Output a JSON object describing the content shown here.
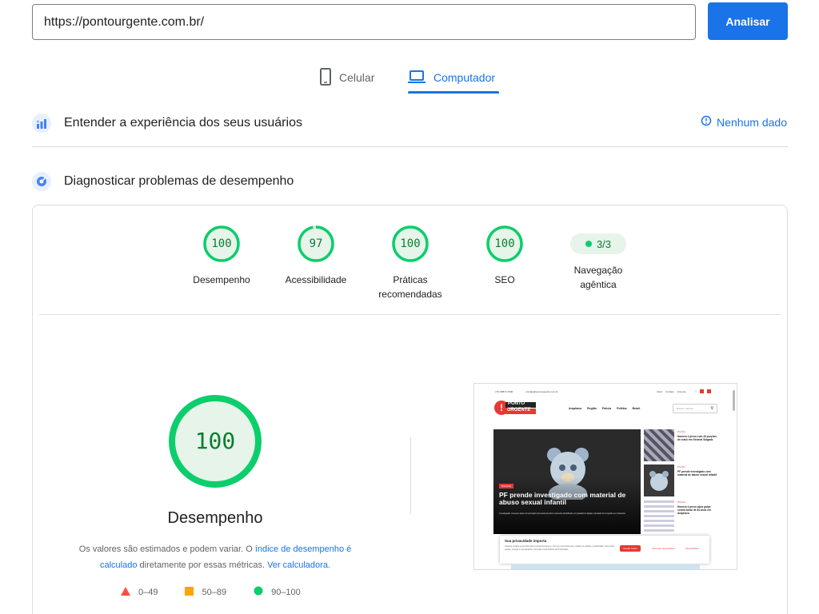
{
  "search": {
    "value": "https://pontourgente.com.br/"
  },
  "analyze_button": "Analisar",
  "device_tabs": {
    "mobile": "Celular",
    "desktop": "Computador",
    "selected": "desktop"
  },
  "field_data": {
    "title": "Entender a experiência dos seus usuários",
    "status": "Nenhum dado"
  },
  "lab_data": {
    "title": "Diagnosticar problemas de desempenho"
  },
  "categories": [
    {
      "score": "100",
      "label": "Desempenho"
    },
    {
      "score": "97",
      "label": "Acessibilidade"
    },
    {
      "score": "100",
      "label": "Práticas recomendadas"
    },
    {
      "score": "100",
      "label": "SEO"
    }
  ],
  "agentic": {
    "value": "3/3",
    "label": "Navegação agêntica"
  },
  "main_score": {
    "score": "100",
    "label": "Desempenho"
  },
  "disclaimer": {
    "text1": "Os valores são estimados e podem variar. O ",
    "link1": "índice de desempenho é calculado",
    "text2": " diretamente por essas métricas. ",
    "link2": "Ver calculadora."
  },
  "legend": [
    "0–49",
    "50–89",
    "90–100"
  ],
  "colors": {
    "pass": "#0cce6b",
    "average": "#ffa400",
    "fail": "#ff4e42",
    "accent": "#1a73e8"
  },
  "screenshot": {
    "top_phone": "(73) 98874-7006",
    "top_email": "contato@pontourgente.com.br",
    "top_links": [
      "Início",
      "Contato",
      "Anuncie"
    ],
    "logo_line1": "PONTO",
    "logo_line2": "URGENTE",
    "nav": [
      "Arapiraca",
      "Região",
      "Polícia",
      "Política",
      "Brasil"
    ],
    "search_placeholder": "Buscar notícias...",
    "hero_tag": "POLÍCIA",
    "hero_headline": "PF prende investigado com material de abuso sexual infantil",
    "hero_sub": "Investigação começou após comunicação internacional sobre conteúdo identificado em plataforma digital; mandado foi cumprido em Girassóis",
    "side_items": [
      {
        "tag": "POLÍCIA",
        "text": "Homem é preso com 40 porções de crack em General Salgado"
      },
      {
        "tag": "POLÍCIA",
        "text": "PF prende investigado com material de abuso sexual infantil"
      },
      {
        "tag": "POLÍCIA",
        "text": "Homem é preso após golpe contra idosa de 84 anos em Arapiraca"
      }
    ],
    "cookie_title": "Sua privacidade importa",
    "cookie_text": "Usamos cookies essenciais para o portal funcionar e, com seu consentimento, cookies de análise e publicidade. Você pode aceitar, recusar ou personalizar. Consulte nossa Política de Privacidade.",
    "cookie_accept": "Aceitar todos",
    "cookie_reject": "Somente necessários",
    "cookie_custom": "Personalizar"
  }
}
